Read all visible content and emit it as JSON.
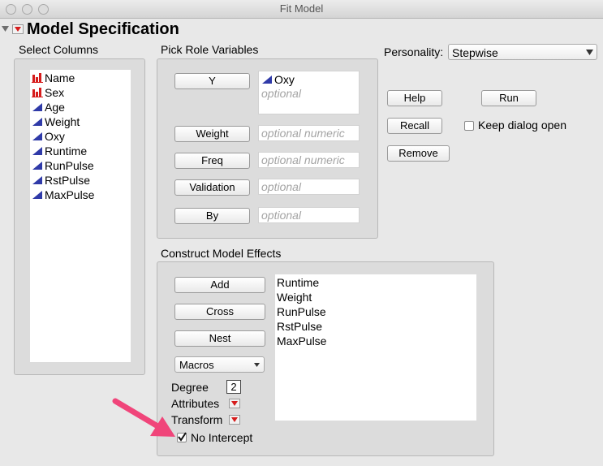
{
  "window": {
    "title": "Fit Model"
  },
  "header": {
    "title": "Model Specification"
  },
  "select_columns": {
    "title": "Select Columns",
    "items": [
      {
        "label": "Name",
        "icon": "nominal-bars-icon"
      },
      {
        "label": "Sex",
        "icon": "nominal-bars-icon"
      },
      {
        "label": "Age",
        "icon": "continuous-triangle-icon"
      },
      {
        "label": "Weight",
        "icon": "continuous-triangle-icon"
      },
      {
        "label": "Oxy",
        "icon": "continuous-triangle-icon"
      },
      {
        "label": "Runtime",
        "icon": "continuous-triangle-icon"
      },
      {
        "label": "RunPulse",
        "icon": "continuous-triangle-icon"
      },
      {
        "label": "RstPulse",
        "icon": "continuous-triangle-icon"
      },
      {
        "label": "MaxPulse",
        "icon": "continuous-triangle-icon"
      }
    ]
  },
  "roles": {
    "title": "Pick Role Variables",
    "y": {
      "button": "Y",
      "value": "Oxy",
      "placeholder": "optional"
    },
    "weight": {
      "button": "Weight",
      "placeholder": "optional numeric"
    },
    "freq": {
      "button": "Freq",
      "placeholder": "optional numeric"
    },
    "validation": {
      "button": "Validation",
      "placeholder": "optional"
    },
    "by": {
      "button": "By",
      "placeholder": "optional"
    }
  },
  "personality": {
    "label": "Personality:",
    "value": "Stepwise"
  },
  "actions": {
    "help": "Help",
    "run": "Run",
    "recall": "Recall",
    "remove": "Remove",
    "keep_open": "Keep dialog open",
    "keep_open_checked": false
  },
  "effects": {
    "title": "Construct Model Effects",
    "add": "Add",
    "cross": "Cross",
    "nest": "Nest",
    "macros": "Macros",
    "degree_label": "Degree",
    "degree_value": "2",
    "attributes": "Attributes",
    "transform": "Transform",
    "no_intercept": "No Intercept",
    "no_intercept_checked": true,
    "items": [
      "Runtime",
      "Weight",
      "RunPulse",
      "RstPulse",
      "MaxPulse"
    ]
  },
  "colors": {
    "accent_red": "#d61c1c",
    "icon_blue": "#2f3aa8",
    "arrow_pink": "#f0457a"
  }
}
